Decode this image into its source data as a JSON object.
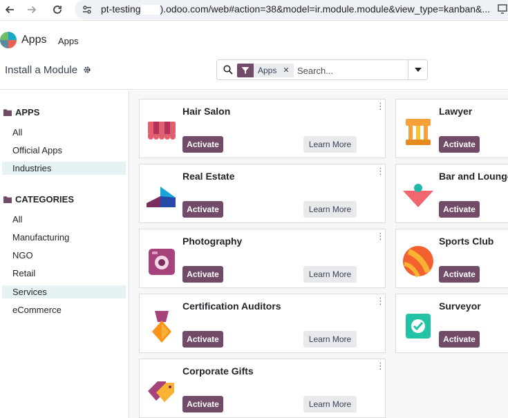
{
  "browser": {
    "url_prefix": "pt-testing",
    "url_suffix": ").odoo.com/web#action=38&model=ir.module.module&view_type=kanban&..."
  },
  "navbar": {
    "app_name": "Apps",
    "menu_item": "Apps"
  },
  "control_panel": {
    "title": "Install a Module",
    "search": {
      "facet_value": "Apps",
      "placeholder": "Search..."
    }
  },
  "sidebar": {
    "apps_header": "APPS",
    "apps_items": [
      {
        "label": "All",
        "active": false
      },
      {
        "label": "Official Apps",
        "active": false
      },
      {
        "label": "Industries",
        "active": true
      }
    ],
    "categories_header": "CATEGORIES",
    "category_items": [
      {
        "label": "All",
        "active": false
      },
      {
        "label": "Manufacturing",
        "active": false
      },
      {
        "label": "NGO",
        "active": false
      },
      {
        "label": "Retail",
        "active": false
      },
      {
        "label": "Services",
        "active": true
      },
      {
        "label": "eCommerce",
        "active": false
      }
    ]
  },
  "buttons": {
    "activate": "Activate",
    "learn_more": "Learn More"
  },
  "modules": [
    {
      "name": "Hair Salon",
      "icon": "awning-icon"
    },
    {
      "name": "Lawyer",
      "icon": "pillars-icon"
    },
    {
      "name": "Real Estate",
      "icon": "real-estate-icon"
    },
    {
      "name": "Bar and Lounge",
      "icon": "cocktail-icon"
    },
    {
      "name": "Photography",
      "icon": "camera-icon"
    },
    {
      "name": "Sports Club",
      "icon": "ball-icon"
    },
    {
      "name": "Certification Auditors",
      "icon": "medal-icon"
    },
    {
      "name": "Surveyor",
      "icon": "check-badge-icon"
    },
    {
      "name": "Corporate Gifts",
      "icon": "gift-tags-icon"
    }
  ],
  "colors": {
    "brand": "#714b67",
    "active_bg": "#e6f2f3"
  }
}
